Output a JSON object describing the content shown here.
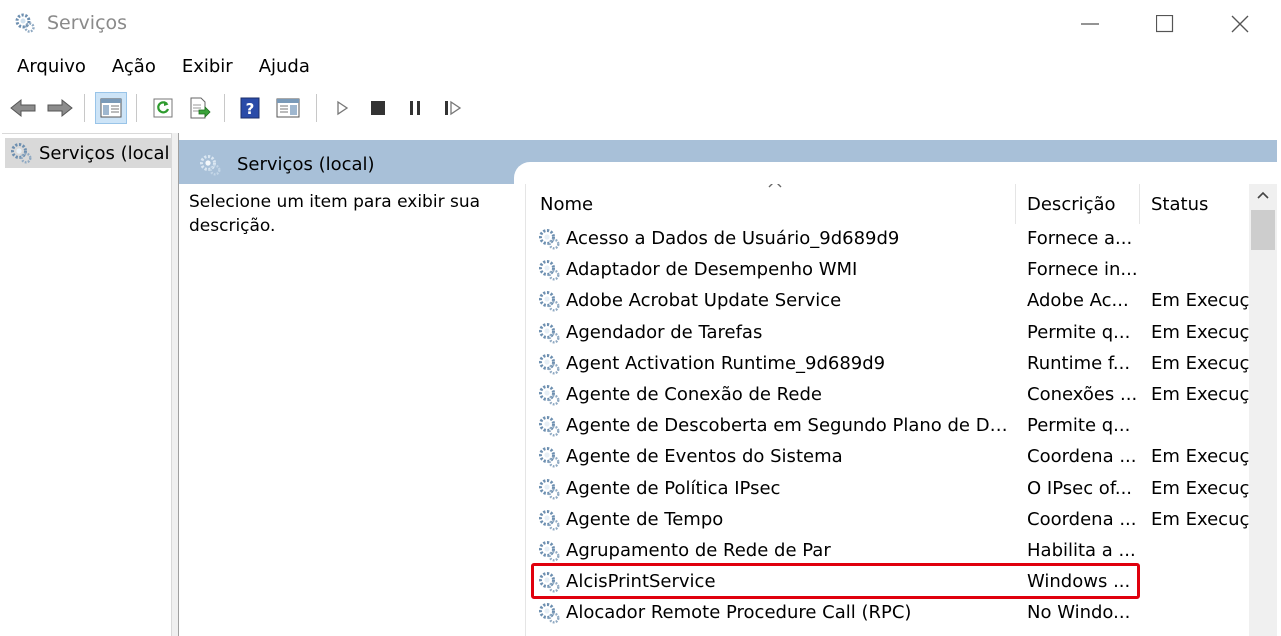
{
  "window": {
    "title": "Serviços",
    "icon": "gears-icon"
  },
  "menu": {
    "items": [
      "Arquivo",
      "Ação",
      "Exibir",
      "Ajuda"
    ]
  },
  "toolbar": {
    "buttons": [
      {
        "name": "back-arrow-icon"
      },
      {
        "name": "forward-arrow-icon"
      },
      {
        "name": "show-hide-console-tree-icon",
        "active": true
      },
      {
        "name": "refresh-icon"
      },
      {
        "name": "export-list-icon"
      },
      {
        "name": "help-icon"
      },
      {
        "name": "properties-view-icon"
      },
      {
        "name": "start-service-icon"
      },
      {
        "name": "stop-service-icon"
      },
      {
        "name": "pause-service-icon"
      },
      {
        "name": "resume-service-icon"
      }
    ]
  },
  "tree": {
    "selected_label": "Serviços (local)"
  },
  "pane": {
    "header_title": "Serviços (local)",
    "description_hint": "Selecione um item para exibir sua descrição."
  },
  "list": {
    "columns": {
      "name": "Nome",
      "description": "Descrição",
      "status": "Status"
    },
    "sorted_column": "Nome",
    "rows": [
      {
        "name": "Acesso a Dados de Usuário_9d689d9",
        "description": "Fornece a...",
        "status": ""
      },
      {
        "name": "Adaptador de Desempenho WMI",
        "description": "Fornece in...",
        "status": ""
      },
      {
        "name": "Adobe Acrobat Update Service",
        "description": "Adobe Ac...",
        "status": "Em Execuç"
      },
      {
        "name": "Agendador de Tarefas",
        "description": "Permite q...",
        "status": "Em Execuç"
      },
      {
        "name": "Agent Activation Runtime_9d689d9",
        "description": "Runtime f...",
        "status": "Em Execuç"
      },
      {
        "name": "Agente de Conexão de Rede",
        "description": "Conexões ...",
        "status": "Em Execuç"
      },
      {
        "name": "Agente de Descoberta em Segundo Plano de Dev...",
        "description": "Permite q...",
        "status": ""
      },
      {
        "name": "Agente de Eventos do Sistema",
        "description": "Coordena ...",
        "status": "Em Execuç"
      },
      {
        "name": "Agente de Política IPsec",
        "description": "O IPsec of...",
        "status": "Em Execuç"
      },
      {
        "name": "Agente de Tempo",
        "description": "Coordena ...",
        "status": "Em Execuç"
      },
      {
        "name": "Agrupamento de Rede de Par",
        "description": "Habilita a ...",
        "status": ""
      },
      {
        "name": "AlcisPrintService",
        "description": "Windows ...",
        "status": "",
        "highlighted": true
      },
      {
        "name": "Alocador Remote Procedure Call (RPC)",
        "description": "No Windo...",
        "status": ""
      }
    ]
  },
  "colors": {
    "header_band": "#a8c0d8",
    "highlight_border": "#e0000d",
    "tree_selected": "#d9d9d9"
  }
}
